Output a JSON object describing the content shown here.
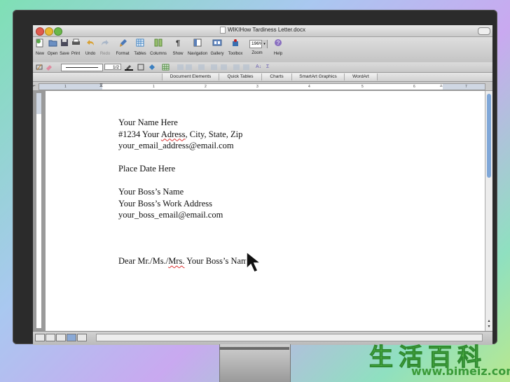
{
  "window": {
    "title": "WIKIHow Tardiness Letter.docx"
  },
  "toolbar": {
    "buttons": [
      {
        "label": "New",
        "icon": "new-document-icon"
      },
      {
        "label": "Open",
        "icon": "open-folder-icon"
      },
      {
        "label": "Save",
        "icon": "save-disk-icon"
      },
      {
        "label": "Print",
        "icon": "printer-icon"
      },
      {
        "label": "Undo",
        "icon": "undo-icon"
      },
      {
        "label": "Redo",
        "icon": "redo-icon"
      },
      {
        "label": "Format",
        "icon": "format-brush-icon"
      },
      {
        "label": "Tables",
        "icon": "table-icon"
      },
      {
        "label": "Columns",
        "icon": "columns-icon"
      },
      {
        "label": "Show",
        "icon": "pilcrow-icon"
      },
      {
        "label": "Navigation",
        "icon": "navigation-pane-icon"
      },
      {
        "label": "Gallery",
        "icon": "gallery-icon"
      },
      {
        "label": "Toolbox",
        "icon": "toolbox-icon"
      },
      {
        "label": "Zoom",
        "icon": "zoom-select-icon"
      },
      {
        "label": "Help",
        "icon": "help-icon"
      }
    ],
    "zoom_value": "196%"
  },
  "format_toolbar": {
    "line_weight": "1/2"
  },
  "elements_ribbon": {
    "tabs": [
      "Document Elements",
      "Quick Tables",
      "Charts",
      "SmartArt Graphics",
      "WordArt"
    ]
  },
  "ruler": {
    "marks": [
      "1",
      "1",
      "2",
      "3",
      "4",
      "5",
      "6",
      "7"
    ]
  },
  "document": {
    "sender_name": "Your Name Here",
    "sender_address_pre": "#1234 Your ",
    "sender_address_misspelled": "Adress",
    "sender_address_post": ", City, State, Zip",
    "sender_email": "your_email_address@email.com",
    "date": "Place Date Here",
    "boss_name": "Your Boss’s Name",
    "boss_address": "Your Boss’s Work Address",
    "boss_email": "your_boss_email@email.com",
    "salutation_pre": "Dear Mr./Ms./",
    "salutation_misspelled": "Mrs.",
    "salutation_post": " Your Boss’s Name"
  },
  "watermark": {
    "chinese": "生活百科",
    "url": "www.bimeiz.com"
  }
}
